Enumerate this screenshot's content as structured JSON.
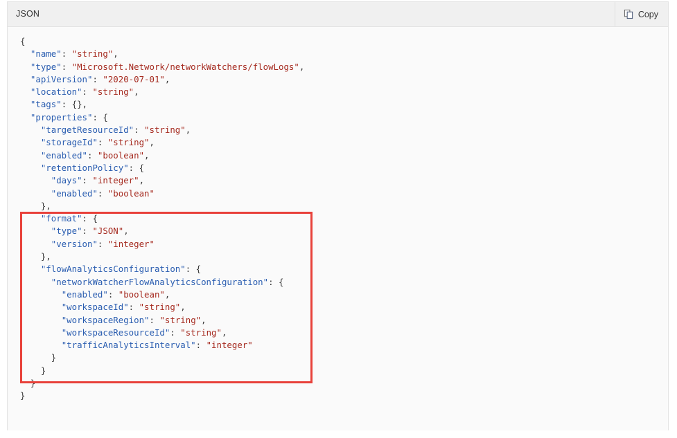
{
  "panel": {
    "title": "JSON",
    "copy_label": "Copy",
    "copy_icon": "copy-pages-icon"
  },
  "colors": {
    "header_bg": "#f0f0f0",
    "body_bg": "#fafafa",
    "panel_border": "#e3e3e3",
    "key": "#2a5db0",
    "string": "#a52a1f",
    "punctuation": "#3b3b3b",
    "annotation": "#e8413a"
  },
  "annotation": {
    "shape": "rectangle",
    "color": "#e8413a",
    "covers_lines": [
      16,
      28
    ]
  },
  "code": {
    "language": "json",
    "lines": [
      {
        "indent": 0,
        "tokens": [
          {
            "t": "p",
            "v": "{"
          }
        ]
      },
      {
        "indent": 1,
        "tokens": [
          {
            "t": "k",
            "v": "\"name\""
          },
          {
            "t": "p",
            "v": ": "
          },
          {
            "t": "s",
            "v": "\"string\""
          },
          {
            "t": "p",
            "v": ","
          }
        ]
      },
      {
        "indent": 1,
        "tokens": [
          {
            "t": "k",
            "v": "\"type\""
          },
          {
            "t": "p",
            "v": ": "
          },
          {
            "t": "s",
            "v": "\"Microsoft.Network/networkWatchers/flowLogs\""
          },
          {
            "t": "p",
            "v": ","
          }
        ]
      },
      {
        "indent": 1,
        "tokens": [
          {
            "t": "k",
            "v": "\"apiVersion\""
          },
          {
            "t": "p",
            "v": ": "
          },
          {
            "t": "s",
            "v": "\"2020-07-01\""
          },
          {
            "t": "p",
            "v": ","
          }
        ]
      },
      {
        "indent": 1,
        "tokens": [
          {
            "t": "k",
            "v": "\"location\""
          },
          {
            "t": "p",
            "v": ": "
          },
          {
            "t": "s",
            "v": "\"string\""
          },
          {
            "t": "p",
            "v": ","
          }
        ]
      },
      {
        "indent": 1,
        "tokens": [
          {
            "t": "k",
            "v": "\"tags\""
          },
          {
            "t": "p",
            "v": ": {},"
          }
        ]
      },
      {
        "indent": 1,
        "tokens": [
          {
            "t": "k",
            "v": "\"properties\""
          },
          {
            "t": "p",
            "v": ": {"
          }
        ]
      },
      {
        "indent": 2,
        "tokens": [
          {
            "t": "k",
            "v": "\"targetResourceId\""
          },
          {
            "t": "p",
            "v": ": "
          },
          {
            "t": "s",
            "v": "\"string\""
          },
          {
            "t": "p",
            "v": ","
          }
        ]
      },
      {
        "indent": 2,
        "tokens": [
          {
            "t": "k",
            "v": "\"storageId\""
          },
          {
            "t": "p",
            "v": ": "
          },
          {
            "t": "s",
            "v": "\"string\""
          },
          {
            "t": "p",
            "v": ","
          }
        ]
      },
      {
        "indent": 2,
        "tokens": [
          {
            "t": "k",
            "v": "\"enabled\""
          },
          {
            "t": "p",
            "v": ": "
          },
          {
            "t": "s",
            "v": "\"boolean\""
          },
          {
            "t": "p",
            "v": ","
          }
        ]
      },
      {
        "indent": 2,
        "tokens": [
          {
            "t": "k",
            "v": "\"retentionPolicy\""
          },
          {
            "t": "p",
            "v": ": {"
          }
        ]
      },
      {
        "indent": 3,
        "tokens": [
          {
            "t": "k",
            "v": "\"days\""
          },
          {
            "t": "p",
            "v": ": "
          },
          {
            "t": "s",
            "v": "\"integer\""
          },
          {
            "t": "p",
            "v": ","
          }
        ]
      },
      {
        "indent": 3,
        "tokens": [
          {
            "t": "k",
            "v": "\"enabled\""
          },
          {
            "t": "p",
            "v": ": "
          },
          {
            "t": "s",
            "v": "\"boolean\""
          }
        ]
      },
      {
        "indent": 2,
        "tokens": [
          {
            "t": "p",
            "v": "},"
          }
        ]
      },
      {
        "indent": 2,
        "tokens": [
          {
            "t": "k",
            "v": "\"format\""
          },
          {
            "t": "p",
            "v": ": {"
          }
        ]
      },
      {
        "indent": 3,
        "tokens": [
          {
            "t": "k",
            "v": "\"type\""
          },
          {
            "t": "p",
            "v": ": "
          },
          {
            "t": "s",
            "v": "\"JSON\""
          },
          {
            "t": "p",
            "v": ","
          }
        ]
      },
      {
        "indent": 3,
        "tokens": [
          {
            "t": "k",
            "v": "\"version\""
          },
          {
            "t": "p",
            "v": ": "
          },
          {
            "t": "s",
            "v": "\"integer\""
          }
        ]
      },
      {
        "indent": 2,
        "tokens": [
          {
            "t": "p",
            "v": "},"
          }
        ]
      },
      {
        "indent": 2,
        "tokens": [
          {
            "t": "k",
            "v": "\"flowAnalyticsConfiguration\""
          },
          {
            "t": "p",
            "v": ": {"
          }
        ]
      },
      {
        "indent": 3,
        "tokens": [
          {
            "t": "k",
            "v": "\"networkWatcherFlowAnalyticsConfiguration\""
          },
          {
            "t": "p",
            "v": ": {"
          }
        ]
      },
      {
        "indent": 4,
        "tokens": [
          {
            "t": "k",
            "v": "\"enabled\""
          },
          {
            "t": "p",
            "v": ": "
          },
          {
            "t": "s",
            "v": "\"boolean\""
          },
          {
            "t": "p",
            "v": ","
          }
        ]
      },
      {
        "indent": 4,
        "tokens": [
          {
            "t": "k",
            "v": "\"workspaceId\""
          },
          {
            "t": "p",
            "v": ": "
          },
          {
            "t": "s",
            "v": "\"string\""
          },
          {
            "t": "p",
            "v": ","
          }
        ]
      },
      {
        "indent": 4,
        "tokens": [
          {
            "t": "k",
            "v": "\"workspaceRegion\""
          },
          {
            "t": "p",
            "v": ": "
          },
          {
            "t": "s",
            "v": "\"string\""
          },
          {
            "t": "p",
            "v": ","
          }
        ]
      },
      {
        "indent": 4,
        "tokens": [
          {
            "t": "k",
            "v": "\"workspaceResourceId\""
          },
          {
            "t": "p",
            "v": ": "
          },
          {
            "t": "s",
            "v": "\"string\""
          },
          {
            "t": "p",
            "v": ","
          }
        ]
      },
      {
        "indent": 4,
        "tokens": [
          {
            "t": "k",
            "v": "\"trafficAnalyticsInterval\""
          },
          {
            "t": "p",
            "v": ": "
          },
          {
            "t": "s",
            "v": "\"integer\""
          }
        ]
      },
      {
        "indent": 3,
        "tokens": [
          {
            "t": "p",
            "v": "}"
          }
        ]
      },
      {
        "indent": 2,
        "tokens": [
          {
            "t": "p",
            "v": "}"
          }
        ]
      },
      {
        "indent": 1,
        "tokens": [
          {
            "t": "p",
            "v": "}"
          }
        ]
      },
      {
        "indent": 0,
        "tokens": [
          {
            "t": "p",
            "v": "}"
          }
        ]
      }
    ]
  }
}
